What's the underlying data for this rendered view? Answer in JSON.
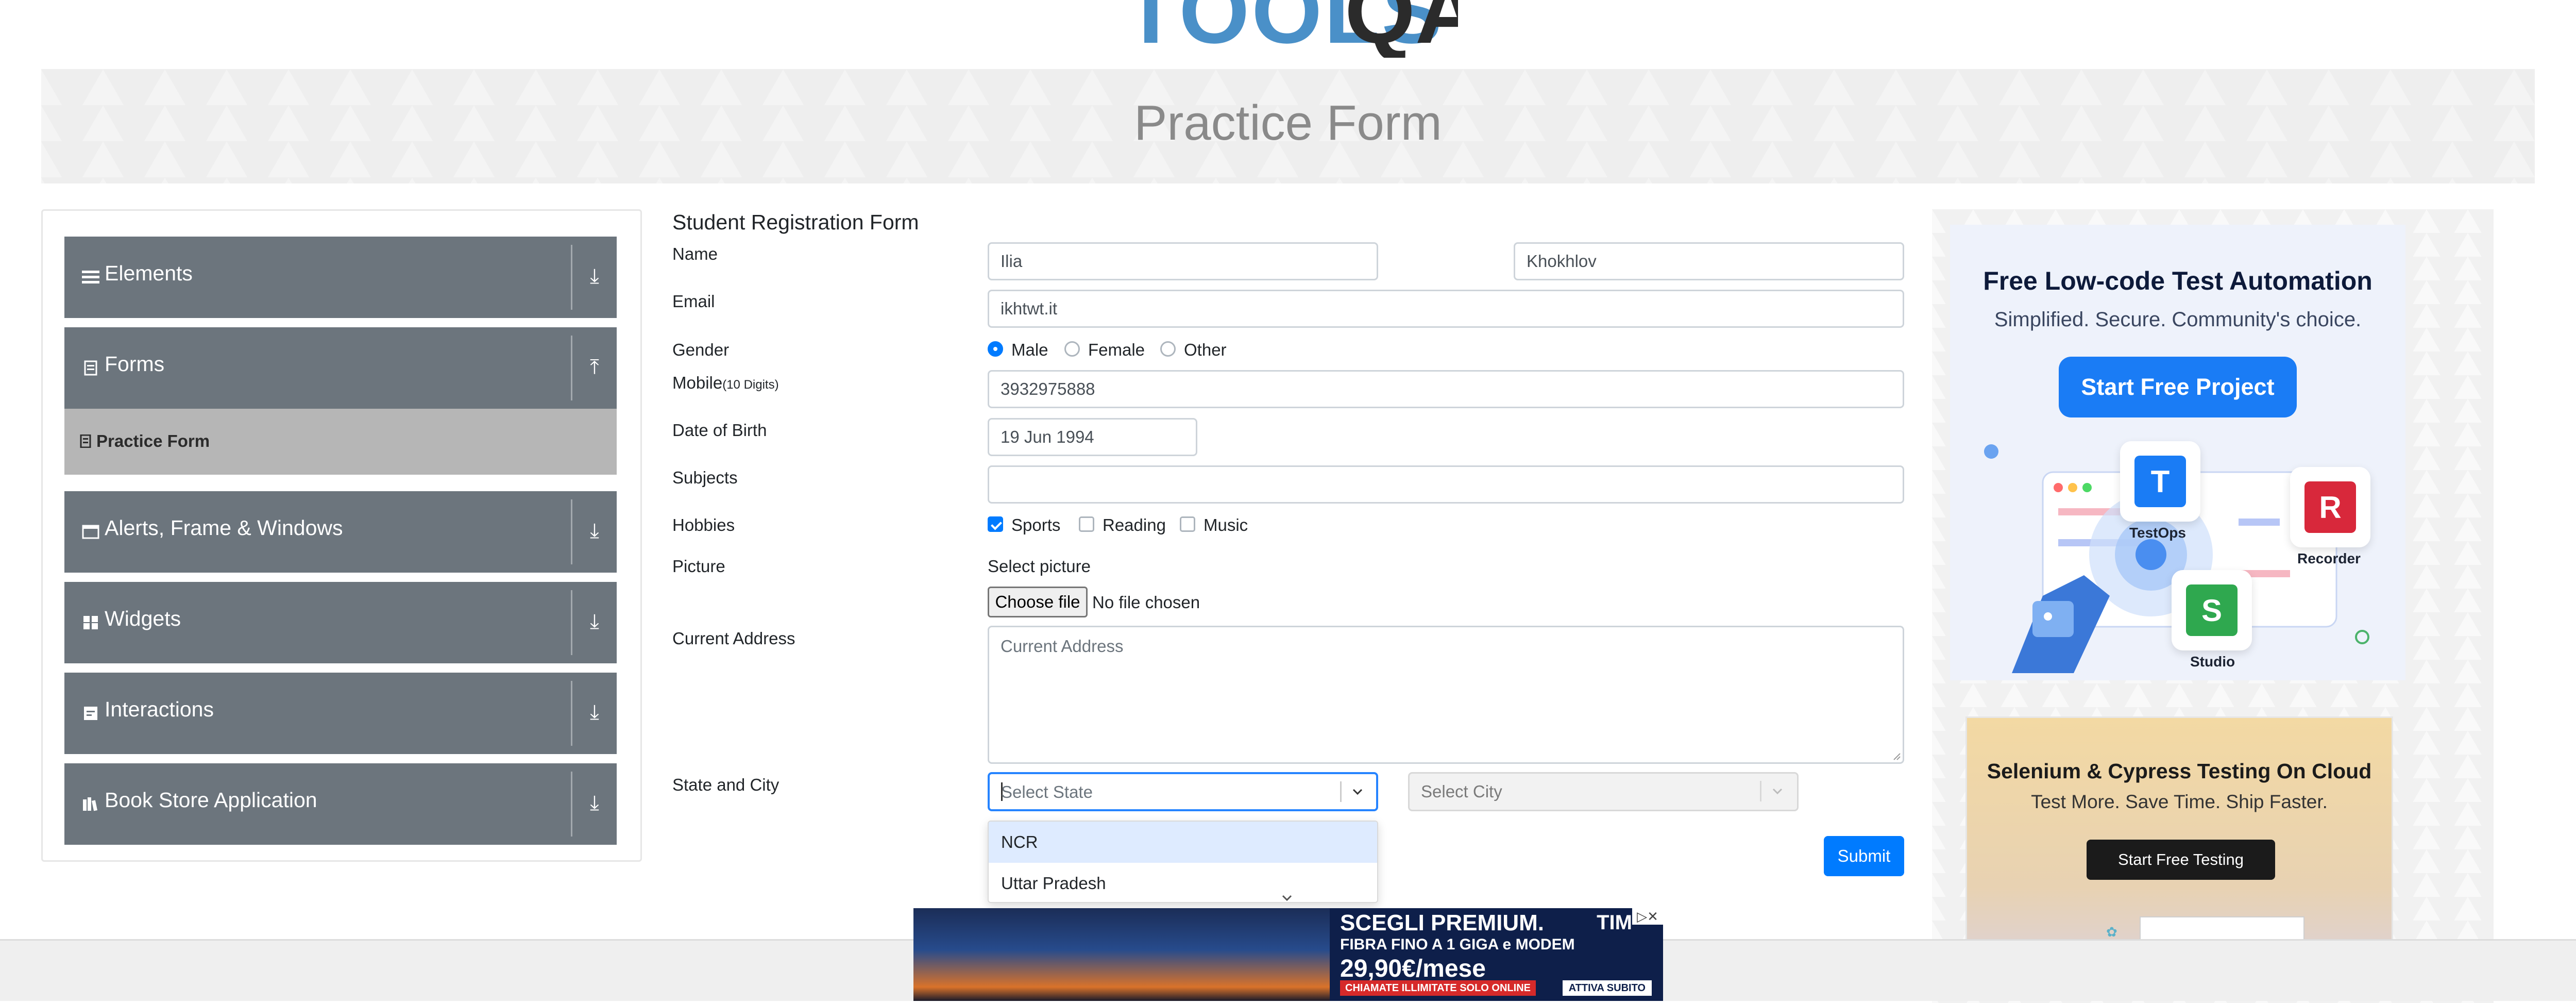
{
  "logo": {
    "part1": "TOOLS",
    "part2": "QA"
  },
  "banner": {
    "title": "Practice Form"
  },
  "sidebar": {
    "groups": [
      {
        "label": "Elements",
        "icon": "hamburger-icon",
        "arrow": "down"
      },
      {
        "label": "Forms",
        "icon": "form-icon",
        "arrow": "up"
      },
      {
        "label": "Alerts, Frame & Windows",
        "icon": "window-icon",
        "arrow": "down"
      },
      {
        "label": "Widgets",
        "icon": "grid-icon",
        "arrow": "down"
      },
      {
        "label": "Interactions",
        "icon": "interact-icon",
        "arrow": "down"
      },
      {
        "label": "Book Store Application",
        "icon": "books-icon",
        "arrow": "down"
      }
    ],
    "sub_items": [
      {
        "label": "Practice Form",
        "icon": "doc-icon"
      }
    ]
  },
  "form": {
    "title": "Student Registration Form",
    "name": {
      "label": "Name",
      "first_value": "Ilia",
      "last_value": "Khokhlov"
    },
    "email": {
      "label": "Email",
      "value": "ikhtwt.it"
    },
    "gender": {
      "label": "Gender",
      "options": [
        "Male",
        "Female",
        "Other"
      ],
      "selected": "Male"
    },
    "mobile": {
      "label": "Mobile",
      "hint": "(10 Digits)",
      "value": "3932975888"
    },
    "dob": {
      "label": "Date of Birth",
      "value": "19 Jun 1994"
    },
    "subjects": {
      "label": "Subjects",
      "value": ""
    },
    "hobbies": {
      "label": "Hobbies",
      "options": [
        "Sports",
        "Reading",
        "Music"
      ],
      "checked": [
        "Sports"
      ]
    },
    "picture": {
      "label": "Picture",
      "select_label": "Select picture",
      "button": "Choose file",
      "file_status": "No file chosen"
    },
    "address": {
      "label": "Current Address",
      "placeholder": "Current Address"
    },
    "state_city": {
      "label": "State and City",
      "state_placeholder": "Select State",
      "city_placeholder": "Select City",
      "state_options_visible": [
        "NCR",
        "Uttar Pradesh"
      ]
    },
    "submit": "Submit"
  },
  "ads": {
    "right1": {
      "title": "Free Low-code Test Automation",
      "subtitle": "Simplified. Secure. Community's choice.",
      "button": "Start Free Project",
      "tiles": [
        "TestOps",
        "Recorder",
        "Studio"
      ]
    },
    "right2": {
      "title": "Selenium & Cypress Testing On Cloud",
      "subtitle": "Test More. Save Time. Ship Faster.",
      "button": "Start Free Testing"
    },
    "bottom": {
      "line1": "SCEGLI PREMIUM.",
      "line2": "FIBRA FINO A 1 GIGA e MODEM",
      "line3": "29,90€/mese",
      "line4": "CHIAMATE ILLIMITATE SOLO ONLINE",
      "cta": "ATTIVA SUBITO",
      "brand": "TIM"
    }
  },
  "colors": {
    "primary": "#007bff",
    "sidebar_group": "#6c757d",
    "sidebar_active": "#b6b6b6",
    "focus": "#2684ff"
  }
}
